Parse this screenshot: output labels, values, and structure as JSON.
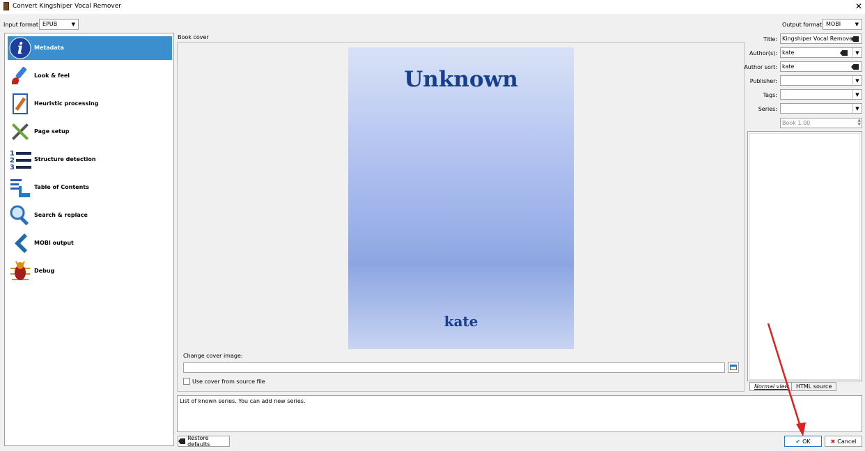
{
  "window": {
    "title": "Convert Kingshiper Vocal Remover",
    "close": "✕"
  },
  "input_format": {
    "label": "Input format:",
    "value": "EPUB"
  },
  "output_format": {
    "label": "Output format:",
    "value": "MOBI"
  },
  "nav": {
    "items": [
      {
        "label": "Metadata",
        "icon": "info-icon",
        "selected": true
      },
      {
        "label": "Look & feel",
        "icon": "paintbrush-icon"
      },
      {
        "label": "Heuristic processing",
        "icon": "document-pencil-icon"
      },
      {
        "label": "Page setup",
        "icon": "tools-icon"
      },
      {
        "label": "Structure detection",
        "icon": "numbered-list-icon"
      },
      {
        "label": "Table of Contents",
        "icon": "toc-icon"
      },
      {
        "label": "Search & replace",
        "icon": "magnifier-icon"
      },
      {
        "label": "MOBI output",
        "icon": "chevron-left-icon"
      },
      {
        "label": "Debug",
        "icon": "bug-icon"
      }
    ]
  },
  "cover": {
    "section_label": "Book cover",
    "title": "Unknown",
    "author": "kate",
    "change_label": "Change cover image:",
    "path_value": "",
    "use_source_label": "Use cover from source file"
  },
  "metadata": {
    "title_label": "Title:",
    "title_value": "Kingshiper Vocal Remover",
    "authors_label": "Author(s):",
    "authors_value": "kate",
    "author_sort_label": "Author sort:",
    "author_sort_value": "kate",
    "publisher_label": "Publisher:",
    "publisher_value": "",
    "tags_label": "Tags:",
    "tags_value": "",
    "series_label": "Series:",
    "series_value": "",
    "series_index_placeholder": "Book 1.00"
  },
  "comments": {
    "tab_normal": "Normal view",
    "tab_html": "HTML source"
  },
  "help_text": "List of known series. You can add new series.",
  "buttons": {
    "restore": "Restore defaults",
    "ok": "OK",
    "cancel": "Cancel"
  },
  "colors": {
    "selection": "#3c8fce",
    "cover_text": "#163f8c",
    "annotation_arrow": "#e02020"
  }
}
